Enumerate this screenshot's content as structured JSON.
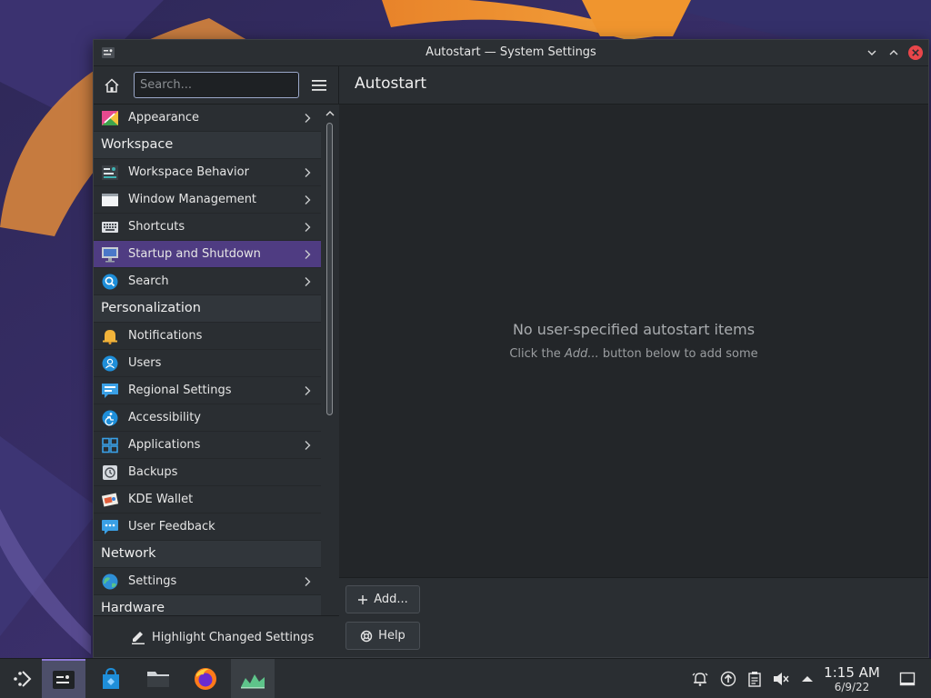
{
  "window": {
    "title": "Autostart — System Settings"
  },
  "sidebar": {
    "search_placeholder": "Search...",
    "footer_label": "Highlight Changed Settings",
    "items": [
      {
        "type": "item",
        "label": "Appearance",
        "icon": "appearance-icon",
        "chevron": true
      },
      {
        "type": "section",
        "label": "Workspace"
      },
      {
        "type": "item",
        "label": "Workspace Behavior",
        "icon": "workspace-behavior-icon",
        "chevron": true
      },
      {
        "type": "item",
        "label": "Window Management",
        "icon": "window-management-icon",
        "chevron": true
      },
      {
        "type": "item",
        "label": "Shortcuts",
        "icon": "keyboard-icon",
        "chevron": true
      },
      {
        "type": "item",
        "label": "Startup and Shutdown",
        "icon": "startup-icon",
        "chevron": true,
        "active": true
      },
      {
        "type": "item",
        "label": "Search",
        "icon": "search-icon",
        "chevron": true
      },
      {
        "type": "section",
        "label": "Personalization"
      },
      {
        "type": "item",
        "label": "Notifications",
        "icon": "bell-icon",
        "chevron": false
      },
      {
        "type": "item",
        "label": "Users",
        "icon": "users-icon",
        "chevron": false
      },
      {
        "type": "item",
        "label": "Regional Settings",
        "icon": "regional-icon",
        "chevron": true
      },
      {
        "type": "item",
        "label": "Accessibility",
        "icon": "accessibility-icon",
        "chevron": false
      },
      {
        "type": "item",
        "label": "Applications",
        "icon": "applications-icon",
        "chevron": true
      },
      {
        "type": "item",
        "label": "Backups",
        "icon": "backups-icon",
        "chevron": false
      },
      {
        "type": "item",
        "label": "KDE Wallet",
        "icon": "wallet-icon",
        "chevron": false
      },
      {
        "type": "item",
        "label": "User Feedback",
        "icon": "feedback-icon",
        "chevron": false
      },
      {
        "type": "section",
        "label": "Network"
      },
      {
        "type": "item",
        "label": "Settings",
        "icon": "globe-icon",
        "chevron": true
      },
      {
        "type": "section",
        "label": "Hardware"
      }
    ]
  },
  "content": {
    "page_title": "Autostart",
    "empty_title": "No user-specified autostart items",
    "empty_hint_prefix": "Click the ",
    "empty_hint_em": "Add...",
    "empty_hint_suffix": " button below to add some",
    "add_label": "Add...",
    "help_label": "Help"
  },
  "taskbar": {
    "time": "1:15 AM",
    "date": "6/9/22"
  },
  "colors": {
    "accent": "#4f3c82",
    "window_bg": "#232629",
    "sidebar_bg": "#2a2e32"
  }
}
